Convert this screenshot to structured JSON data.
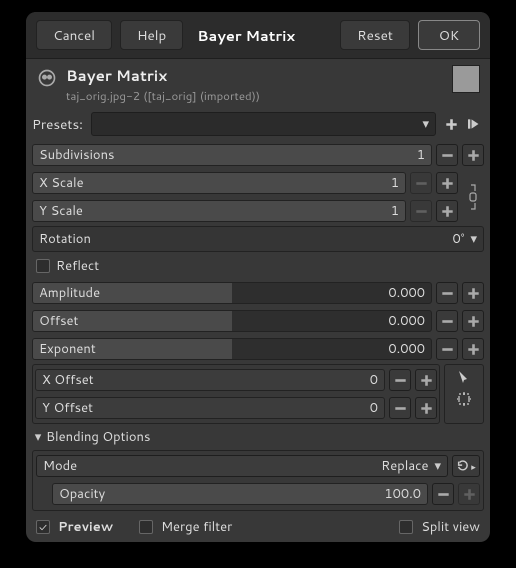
{
  "topbar": {
    "cancel": "Cancel",
    "help": "Help",
    "title": "Bayer Matrix",
    "reset": "Reset",
    "ok": "OK"
  },
  "header": {
    "title": "Bayer Matrix",
    "subtitle": "taj_orig.jpg-2 ([taj_orig] (imported))"
  },
  "presets": {
    "label": "Presets:"
  },
  "params": {
    "subdivisions": {
      "label": "Subdivisions",
      "value": "1"
    },
    "xscale": {
      "label": "X Scale",
      "value": "1"
    },
    "yscale": {
      "label": "Y Scale",
      "value": "1"
    },
    "rotation": {
      "label": "Rotation",
      "value": "0°"
    },
    "reflect": {
      "label": "Reflect"
    },
    "amplitude": {
      "label": "Amplitude",
      "value": "0.000"
    },
    "offset": {
      "label": "Offset",
      "value": "0.000"
    },
    "exponent": {
      "label": "Exponent",
      "value": "0.000"
    },
    "xoffset": {
      "label": "X Offset",
      "value": "0"
    },
    "yoffset": {
      "label": "Y Offset",
      "value": "0"
    }
  },
  "blending": {
    "title": "Blending Options",
    "mode_label": "Mode",
    "mode_value": "Replace",
    "opacity_label": "Opacity",
    "opacity_value": "100.0"
  },
  "footer": {
    "preview": "Preview",
    "merge": "Merge filter",
    "split": "Split view"
  }
}
